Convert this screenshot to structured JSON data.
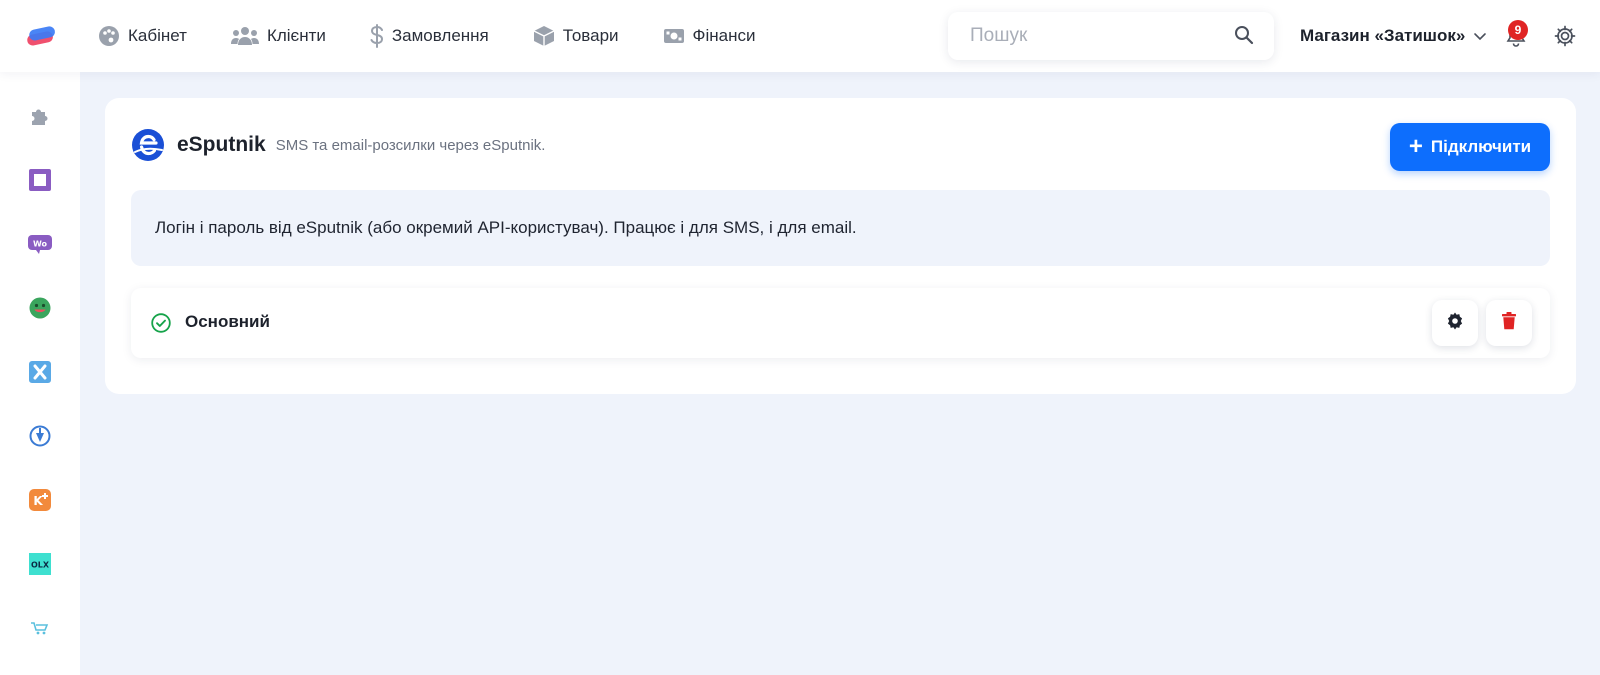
{
  "nav": {
    "items": [
      {
        "label": "Кабінет",
        "icon": "palette-icon"
      },
      {
        "label": "Клієнти",
        "icon": "users-icon"
      },
      {
        "label": "Замовлення",
        "icon": "dollar-icon"
      },
      {
        "label": "Товари",
        "icon": "box-icon"
      },
      {
        "label": "Фінанси",
        "icon": "money-icon"
      }
    ]
  },
  "search": {
    "placeholder": "Пошук",
    "value": ""
  },
  "store": {
    "name": "Магазин «Затишок»"
  },
  "notifications": {
    "count": "9"
  },
  "sidebar": {
    "items": [
      {
        "icon": "puzzle-icon",
        "color": "#9ca3af"
      },
      {
        "icon": "square-app-icon",
        "color": "#8a5cc2"
      },
      {
        "icon": "woo-icon",
        "color": "#8a5cc2"
      },
      {
        "icon": "smile-app-icon",
        "color": "#3aa55d"
      },
      {
        "icon": "x-app-icon",
        "color": "#5aa9e6"
      },
      {
        "icon": "pin-app-icon",
        "color": "#3b7bd4"
      },
      {
        "icon": "k-plus-app-icon",
        "color": "#f28a3c"
      },
      {
        "icon": "olx-app-icon",
        "color": "#3ee0d0"
      },
      {
        "icon": "cart-app-icon",
        "color": "#5bc0de"
      }
    ]
  },
  "integration": {
    "name": "eSputnik",
    "subtitle": "SMS та email-розсилки через eSputnik.",
    "connect_label": "Підключити",
    "info_text": "Логін і пароль від eSputnik (або окремий API-користувач). Працює і для SMS, і для email.",
    "accounts": [
      {
        "name": "Основний",
        "status": "active"
      }
    ]
  },
  "colors": {
    "accent": "#0d6efd",
    "danger": "#e02424",
    "success": "#16a34a",
    "background": "#eff3fb"
  }
}
